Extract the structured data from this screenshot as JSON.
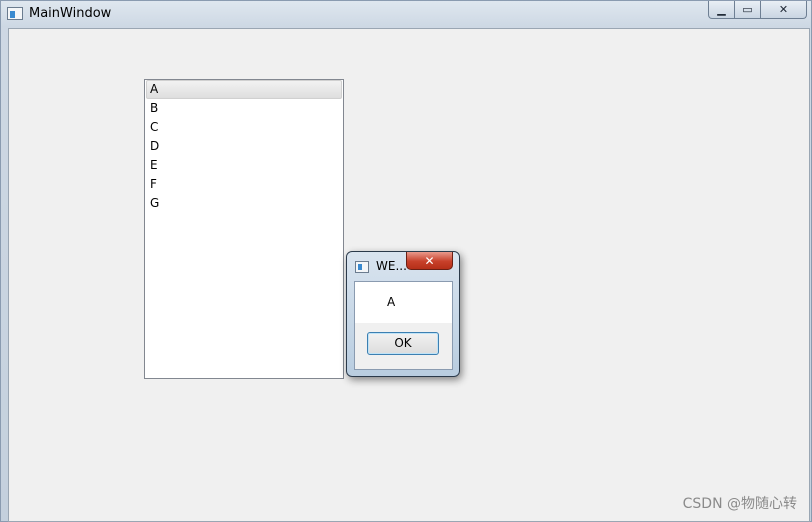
{
  "window": {
    "title": "MainWindow",
    "controls": {
      "minimize": "▁",
      "maximize": "▭",
      "close": "✕"
    }
  },
  "list": {
    "items": [
      "A",
      "B",
      "C",
      "D",
      "E",
      "F",
      "G"
    ],
    "selected_index": 0
  },
  "message_box": {
    "title": "WE...",
    "close": "✕",
    "text": "A",
    "ok_label": "OK"
  },
  "watermark": "CSDN @物随心转"
}
